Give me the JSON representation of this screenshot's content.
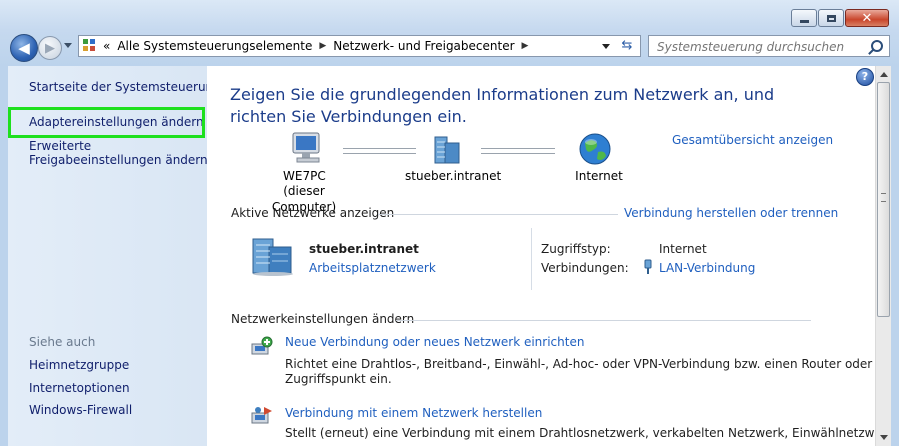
{
  "window": {
    "caption_buttons": {
      "minimize": "minimize",
      "maximize": "maximize",
      "close": "✕"
    }
  },
  "address_bar": {
    "overflow_marker": "«",
    "breadcrumbs": [
      "Alle Systemsteuerungselemente",
      "Netzwerk- und Freigabecenter"
    ],
    "separator": "▶"
  },
  "search": {
    "placeholder": "Systemsteuerung durchsuchen"
  },
  "sidebar": {
    "home": "Startseite der Systemsteuerung",
    "items": [
      {
        "label": "Adaptereinstellungen ändern",
        "highlighted": true
      },
      {
        "label_line1": "Erweiterte",
        "label_line2": "Freigabeeinstellungen ändern"
      }
    ],
    "see_also_title": "Siehe auch",
    "see_also": [
      "Heimnetzgruppe",
      "Internetoptionen",
      "Windows-Firewall"
    ]
  },
  "main": {
    "help": "?",
    "heading": "Zeigen Sie die grundlegenden Informationen zum Netzwerk an, und richten Sie Verbindungen ein.",
    "full_map_link": "Gesamtübersicht anzeigen",
    "map_nodes": {
      "computer": {
        "name": "WE7PC",
        "sub": "(dieser Computer)"
      },
      "network": {
        "name": "stueber.intranet"
      },
      "internet": {
        "name": "Internet"
      }
    },
    "active_networks": {
      "title": "Aktive Netzwerke anzeigen",
      "connect_link": "Verbindung herstellen oder trennen",
      "network_name": "stueber.intranet",
      "network_type": "Arbeitsplatznetzwerk",
      "access_type_label": "Zugriffstyp:",
      "access_type_value": "Internet",
      "connections_label": "Verbindungen:",
      "connections_value": "LAN-Verbindung"
    },
    "change_settings": {
      "title": "Netzwerkeinstellungen ändern",
      "tasks": [
        {
          "title": "Neue Verbindung oder neues Netzwerk einrichten",
          "desc_line1": "Richtet eine Drahtlos-, Breitband-, Einwähl-, Ad-hoc- oder VPN-Verbindung bzw. einen Router oder",
          "desc_line2": "Zugriffspunkt ein."
        },
        {
          "title": "Verbindung mit einem Netzwerk herstellen",
          "desc_line1": "Stellt (erneut) eine Verbindung mit einem Drahtlosnetzwerk, verkabelten Netzwerk, Einwählnetzwerk"
        }
      ]
    }
  },
  "colors": {
    "highlight_box": "#1ee01e",
    "link": "#1f5fbf",
    "heading": "#1b3c8a",
    "nav_link": "#0f1e6b"
  }
}
